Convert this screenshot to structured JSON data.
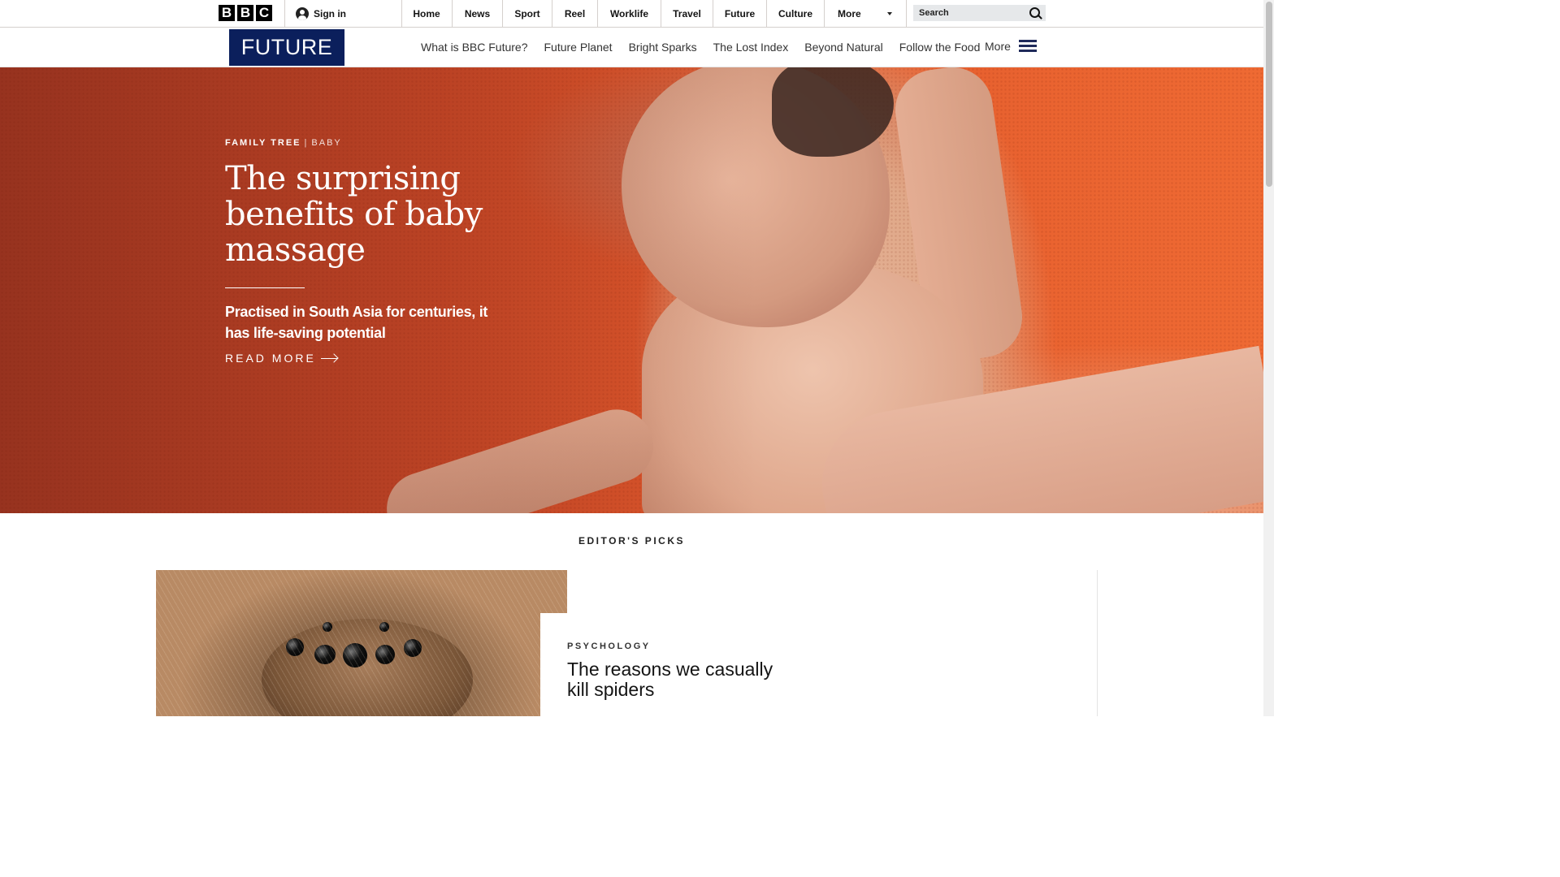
{
  "topbar": {
    "logo_letters": [
      "B",
      "B",
      "C"
    ],
    "sign_in": "Sign in",
    "nav": [
      "Home",
      "News",
      "Sport",
      "Reel",
      "Worklife",
      "Travel",
      "Future",
      "Culture"
    ],
    "more": "More",
    "search_placeholder": "Search"
  },
  "section_nav": {
    "logo": "FUTURE",
    "links": [
      "What is BBC Future?",
      "Future Planet",
      "Bright Sparks",
      "The Lost Index",
      "Beyond Natural",
      "Follow the Food"
    ],
    "more": "More"
  },
  "hero": {
    "kicker": "FAMILY TREE",
    "kicker_sep": "|",
    "kicker_sub": "BABY",
    "title": "The surprising benefits of baby massage",
    "summary": "Practised in South Asia for centuries, it has life-saving potential",
    "read_more": "READ MORE"
  },
  "editors_picks": {
    "title": "EDITOR'S PICKS",
    "items": [
      {
        "category": "PSYCHOLOGY",
        "headline": "The reasons we casually kill spiders"
      }
    ]
  },
  "icons": [
    "user-icon",
    "chevron-down-icon",
    "search-icon",
    "menu-icon",
    "arrow-right-icon"
  ],
  "colors": {
    "future_brand": "#0b1f5c",
    "hero_background": "#e25a2c"
  }
}
